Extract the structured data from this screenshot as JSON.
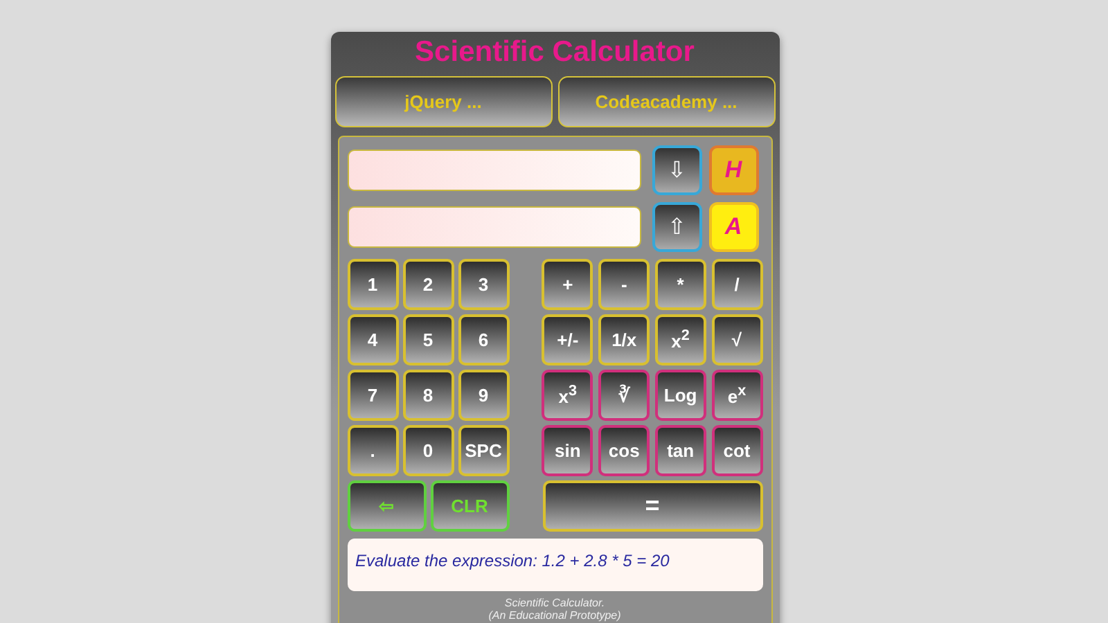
{
  "title": "Scientific Calculator",
  "links": [
    "jQuery ...",
    "Codeacademy ..."
  ],
  "displays": [
    {
      "arrow": "⇩",
      "mode": "H",
      "kind": "dark"
    },
    {
      "arrow": "⇧",
      "mode": "A",
      "kind": "bright"
    }
  ],
  "digits": [
    "1",
    "2",
    "3",
    "4",
    "5",
    "6",
    "7",
    "8",
    "9",
    ".",
    "0",
    "SPC"
  ],
  "operators": [
    {
      "label": "+",
      "kind": "basic"
    },
    {
      "label": "-",
      "kind": "basic"
    },
    {
      "label": "*",
      "kind": "basic"
    },
    {
      "label": "/",
      "kind": "basic"
    },
    {
      "label": "+/-",
      "kind": "basic"
    },
    {
      "label": "1/x",
      "kind": "basic"
    },
    {
      "label": "x$^{2}$",
      "kind": "basic"
    },
    {
      "label": "√",
      "kind": "basic"
    },
    {
      "label": "x$^{3}$",
      "kind": "function"
    },
    {
      "label": "∛",
      "kind": "function"
    },
    {
      "label": "Log",
      "kind": "function"
    },
    {
      "label": "e$^{x}$",
      "kind": "function"
    },
    {
      "label": "sin",
      "kind": "function"
    },
    {
      "label": "cos",
      "kind": "function"
    },
    {
      "label": "tan",
      "kind": "function"
    },
    {
      "label": "cot",
      "kind": "function"
    }
  ],
  "edit_keys": [
    "⇦",
    "CLR"
  ],
  "equals": "=",
  "message": "Evaluate the expression: 1.2 + 2.8 * 5 = 20",
  "footer": [
    "Scientific Calculator.",
    "(An Educational Prototype)"
  ]
}
